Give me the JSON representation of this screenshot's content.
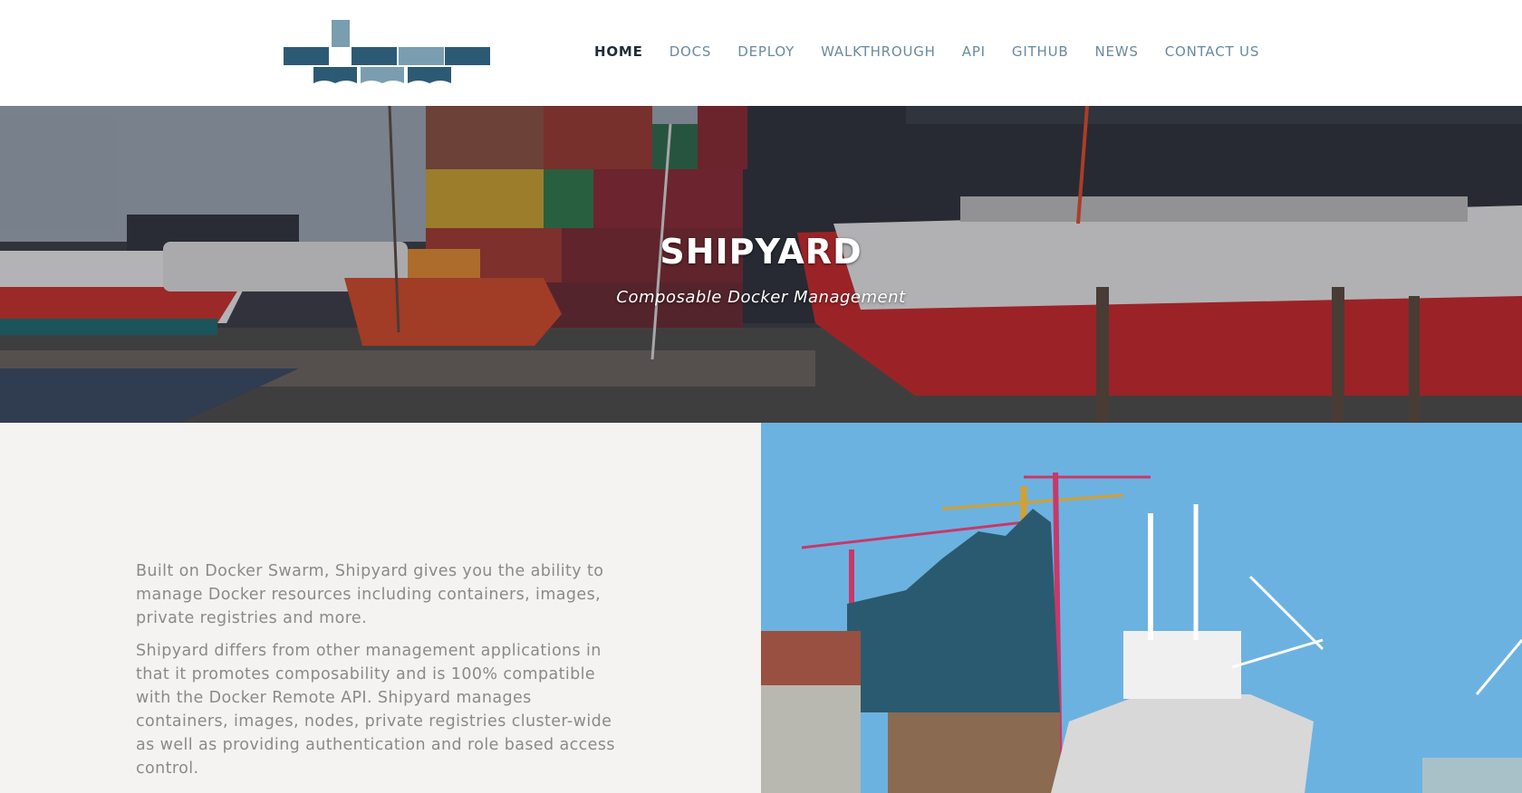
{
  "nav": {
    "items": [
      {
        "label": "HOME",
        "active": true
      },
      {
        "label": "DOCS"
      },
      {
        "label": "DEPLOY"
      },
      {
        "label": "WALKTHROUGH"
      },
      {
        "label": "API"
      },
      {
        "label": "GITHUB"
      },
      {
        "label": "NEWS"
      },
      {
        "label": "CONTACT US"
      }
    ]
  },
  "brand": {
    "logo_icon": "shipyard-containers-logo",
    "colors": {
      "dark": "#2c5a74",
      "light": "#7a9db0",
      "nav_active": "#1f2d36",
      "nav": "#6a8aa0"
    }
  },
  "hero": {
    "title": "SHIPYARD",
    "subtitle": "Composable Docker Management"
  },
  "content": {
    "paragraph1": "Built on Docker Swarm, Shipyard gives you the ability to manage Docker resources including containers, images, private registries and more.",
    "paragraph2": "Shipyard differs from other management applications in that it promotes composability and is 100% compatible with the Docker Remote API. Shipyard manages containers, images, nodes, private registries cluster-wide as well as providing authentication and role based access control."
  }
}
